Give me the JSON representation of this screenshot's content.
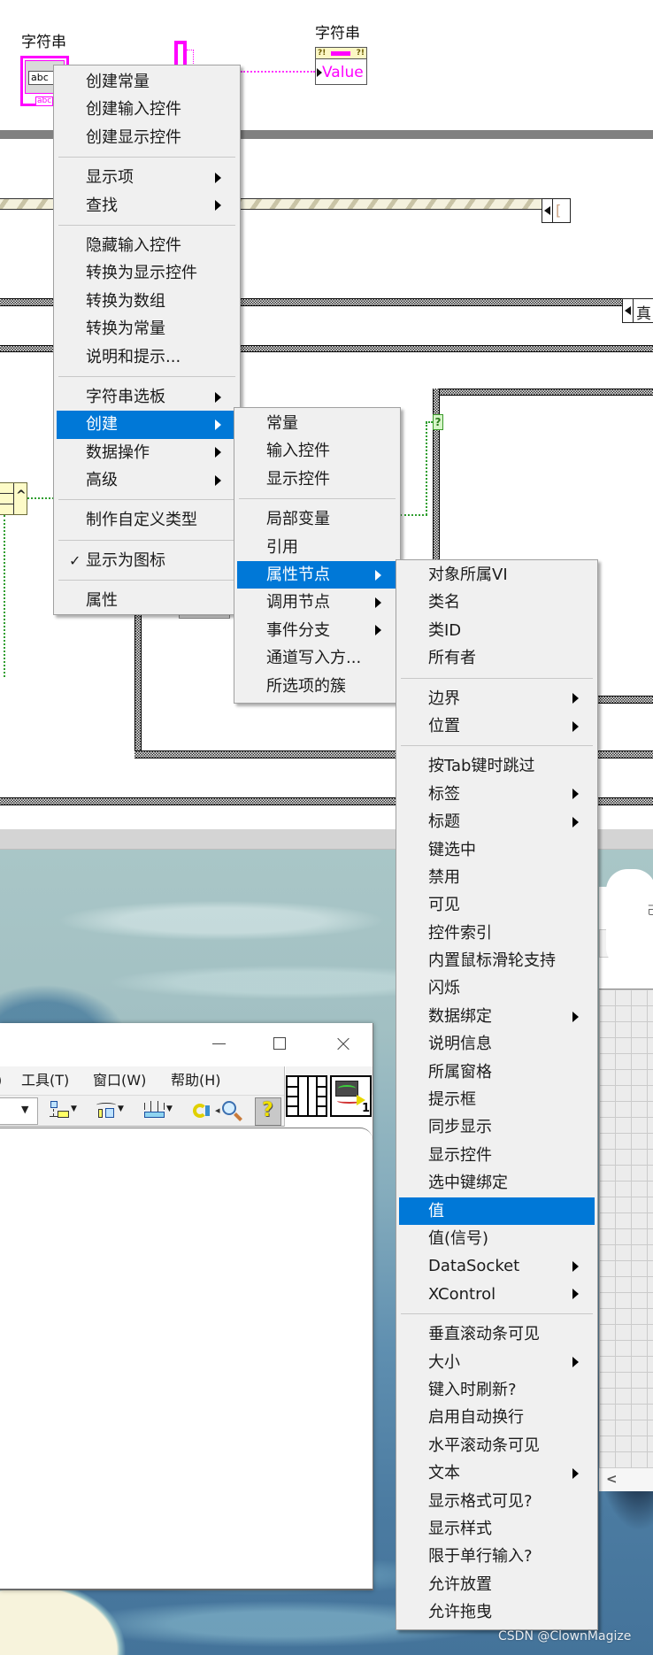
{
  "diagram": {
    "control_label": "字符串",
    "control_text": "abc",
    "control_type_tag": "abc",
    "indicator_label": "字符串",
    "property_node": {
      "header_left": "?!",
      "header_right": "?!",
      "property": "Value"
    },
    "hatched_selector_text": "[",
    "case_selector_text": "真",
    "enum_glyph": "^",
    "selector_terminal_glyph": "?"
  },
  "context_menu": {
    "items": [
      {
        "label": "创建常量"
      },
      {
        "label": "创建输入控件"
      },
      {
        "label": "创建显示控件"
      },
      {
        "separator": true
      },
      {
        "label": "显示项",
        "submenu": true
      },
      {
        "label": "查找",
        "submenu": true
      },
      {
        "separator": true
      },
      {
        "label": "隐藏输入控件"
      },
      {
        "label": "转换为显示控件"
      },
      {
        "label": "转换为数组"
      },
      {
        "label": "转换为常量"
      },
      {
        "label": "说明和提示..."
      },
      {
        "separator": true
      },
      {
        "label": "字符串选板",
        "submenu": true
      },
      {
        "label": "创建",
        "submenu": true,
        "highlighted": true
      },
      {
        "label": "数据操作",
        "submenu": true
      },
      {
        "label": "高级",
        "submenu": true
      },
      {
        "separator": true
      },
      {
        "label": "制作自定义类型"
      },
      {
        "separator": true
      },
      {
        "label": "显示为图标",
        "checked": true
      },
      {
        "separator": true
      },
      {
        "label": "属性"
      }
    ]
  },
  "create_submenu": {
    "items": [
      {
        "label": "常量"
      },
      {
        "label": "输入控件"
      },
      {
        "label": "显示控件"
      },
      {
        "separator": true
      },
      {
        "label": "局部变量"
      },
      {
        "label": "引用"
      },
      {
        "label": "属性节点",
        "submenu": true,
        "highlighted": true
      },
      {
        "label": "调用节点",
        "submenu": true
      },
      {
        "label": "事件分支",
        "submenu": true
      },
      {
        "label": "通道写入方..."
      },
      {
        "label": "所选项的簇"
      }
    ]
  },
  "property_node_submenu": {
    "items": [
      {
        "label": "对象所属VI"
      },
      {
        "label": "类名"
      },
      {
        "label": "类ID"
      },
      {
        "label": "所有者"
      },
      {
        "separator": true
      },
      {
        "label": "边界",
        "submenu": true
      },
      {
        "label": "位置",
        "submenu": true
      },
      {
        "separator": true
      },
      {
        "label": "按Tab键时跳过"
      },
      {
        "label": "标签",
        "submenu": true
      },
      {
        "label": "标题",
        "submenu": true
      },
      {
        "label": "键选中"
      },
      {
        "label": "禁用"
      },
      {
        "label": "可见"
      },
      {
        "label": "控件索引"
      },
      {
        "label": "内置鼠标滑轮支持"
      },
      {
        "label": "闪烁"
      },
      {
        "label": "数据绑定",
        "submenu": true
      },
      {
        "label": "说明信息"
      },
      {
        "label": "所属窗格"
      },
      {
        "label": "提示框"
      },
      {
        "label": "同步显示"
      },
      {
        "label": "显示控件"
      },
      {
        "label": "选中键绑定"
      },
      {
        "label": "值",
        "highlighted": true
      },
      {
        "label": "值(信号)"
      },
      {
        "label": "DataSocket",
        "submenu": true
      },
      {
        "label": "XControl",
        "submenu": true
      },
      {
        "separator": true
      },
      {
        "label": "垂直滚动条可见"
      },
      {
        "label": "大小",
        "submenu": true
      },
      {
        "label": "键入时刷新?"
      },
      {
        "label": "启用自动换行"
      },
      {
        "label": "水平滚动条可见"
      },
      {
        "label": "文本",
        "submenu": true
      },
      {
        "label": "显示格式可见?"
      },
      {
        "label": "显示样式"
      },
      {
        "label": "限于单行输入?"
      },
      {
        "label": "允许放置"
      },
      {
        "label": "允许拖曳"
      }
    ]
  },
  "window": {
    "menubar": [
      ")",
      "工具(T)",
      "窗口(W)",
      "帮助(H)"
    ],
    "toolbar": {
      "dropdown_arrow": "▼",
      "help_glyph": "?",
      "search_prefix": "◂"
    },
    "vi_icon_number": "1"
  },
  "right_panel": {
    "partial_text": "己",
    "scroll_left_glyph": "<"
  },
  "icons": {
    "checkmark": "✓",
    "submenu_arrow": "triangle-right",
    "minimize": "minimize-icon",
    "maximize": "maximize-icon",
    "close": "close-icon"
  },
  "colors": {
    "menu_highlight": "#0078d7",
    "menu_background": "#f0f0f0",
    "string_wire": "#ff00ff",
    "boolean_wire": "#2f9e2f"
  },
  "watermark": "CSDN @ClownMagize"
}
